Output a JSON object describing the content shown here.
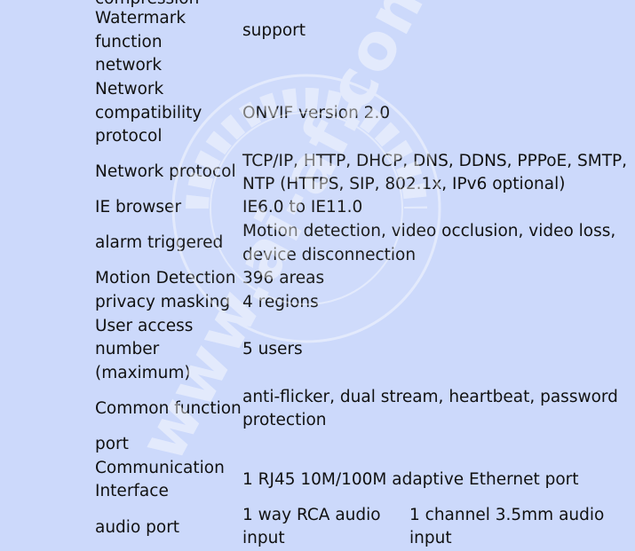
{
  "spec_rows": {
    "compression_label_cut": "compression",
    "watermark_label_1": "Watermark",
    "watermark_label_2": "function",
    "watermark_value": "support",
    "network_label": "network",
    "compat_label_1": "Network",
    "compat_label_2": "compatibility",
    "compat_label_3": "protocol",
    "compat_value": "ONVIF version 2.0",
    "protocol_label": "Network protocol",
    "protocol_value_1": "TCP/IP, HTTP, DHCP, DNS, DDNS, PPPoE, SMTP,",
    "protocol_value_2": "NTP (HTTPS, SIP, 802.1x, IPv6 optional)",
    "ie_label": "IE browser",
    "ie_value": "IE6.0 to IE11.0",
    "alarm_label": "alarm triggered",
    "alarm_value_1": "Motion detection, video occlusion, video loss,",
    "alarm_value_2": "device disconnection",
    "motion_label": "Motion Detection",
    "motion_value": "396 areas",
    "privacy_label": "privacy masking",
    "privacy_value": "4 regions",
    "users_label_1": "User access",
    "users_label_2": "number",
    "users_label_3": "(maximum)",
    "users_value": "5 users",
    "common_label": "Common function",
    "common_value_1": "anti-flicker, dual stream, heartbeat, password",
    "common_value_2": "protection",
    "port_label": "port",
    "comm_label_1": "Communication",
    "comm_label_2": "Interface",
    "comm_value": "1 RJ45 10M/100M adaptive Ethernet port",
    "audio_label": "audio port",
    "audio_value_a1": "1 way RCA audio",
    "audio_value_a2": "input",
    "audio_value_b1": "1 channel 3.5mm audio",
    "audio_value_b2": "input"
  },
  "watermark": {
    "text": "www.ai-af.com",
    "seal_text": "Copyright of"
  },
  "colors": {
    "background": "#ccd9fb",
    "text": "#111111",
    "watermark": "#ffffff"
  }
}
